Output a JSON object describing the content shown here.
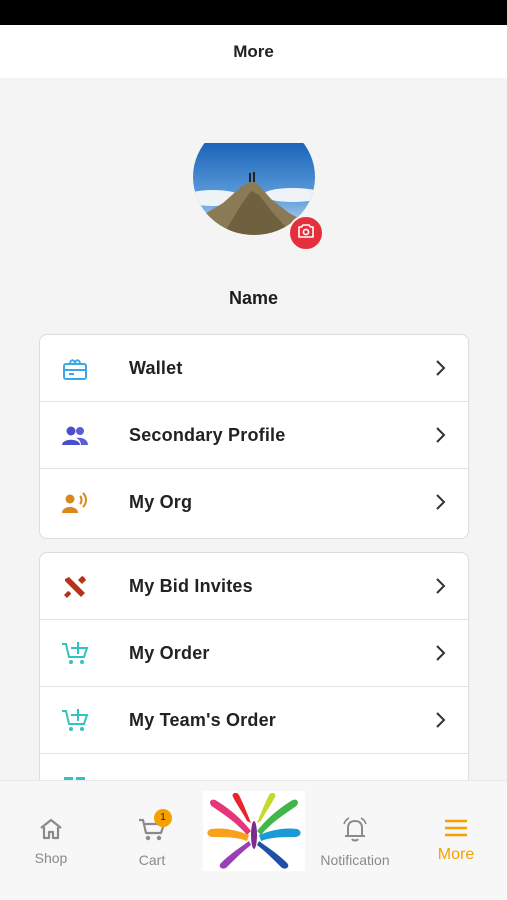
{
  "header": {
    "title": "More"
  },
  "profile": {
    "name": "Name"
  },
  "menu_group_1": [
    {
      "label": "Wallet",
      "icon": "wallet-icon",
      "color": "#3aa8e8"
    },
    {
      "label": "Secondary Profile",
      "icon": "users-icon",
      "color": "#4a4fc7"
    },
    {
      "label": "My Org",
      "icon": "org-icon",
      "color": "#d9871a"
    }
  ],
  "menu_group_2": [
    {
      "label": "My Bid Invites",
      "icon": "tools-icon",
      "color": "#b5331a"
    },
    {
      "label": "My Order",
      "icon": "cart-plus-icon",
      "color": "#2fc4c0"
    },
    {
      "label": "My Team's Order",
      "icon": "cart-plus-icon",
      "color": "#2fc4c0"
    },
    {
      "label": "",
      "icon": "grid-icon",
      "color": "#2fc4c0"
    }
  ],
  "tabbar": {
    "shop": "Shop",
    "cart": "Cart",
    "cart_badge": "1",
    "notification": "Notification",
    "more": "More",
    "active_color": "#f5a000",
    "inactive_color": "#8a8a8a"
  },
  "colors": {
    "camera_button": "#e5303b"
  }
}
